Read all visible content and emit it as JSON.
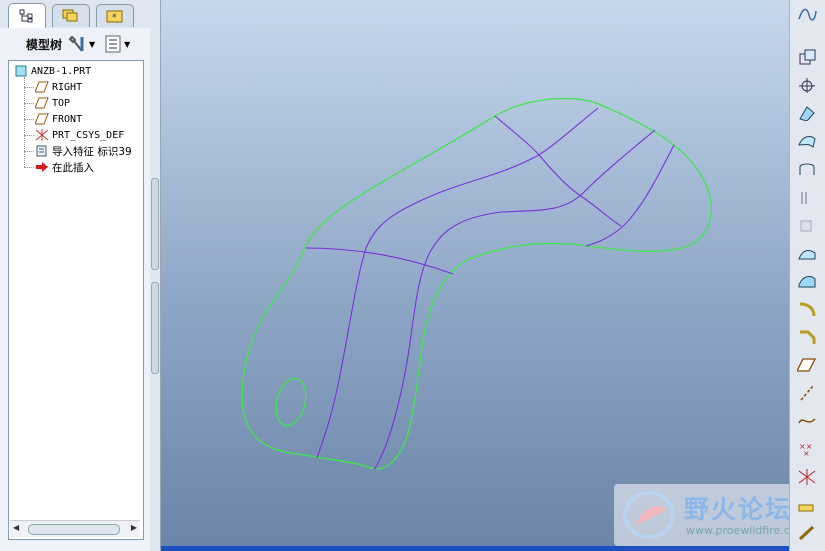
{
  "model_tree": {
    "title": "模型树",
    "items": [
      {
        "label": "ANZB-1.PRT",
        "icon": "part-icon"
      },
      {
        "label": "RIGHT",
        "icon": "datum-plane-icon"
      },
      {
        "label": "TOP",
        "icon": "datum-plane-icon"
      },
      {
        "label": "FRONT",
        "icon": "datum-plane-icon"
      },
      {
        "label": "PRT_CSYS_DEF",
        "icon": "csys-icon"
      },
      {
        "label": "导入特征 标识39",
        "icon": "import-feature-icon"
      },
      {
        "label": "在此插入",
        "icon": "insert-here-icon"
      }
    ]
  },
  "tabs": [
    "model-tree-tab",
    "folder-browser-tab",
    "favorites-tab"
  ],
  "right_toolbar": [
    "sketched-curve-icon",
    "datum-plane-tool-icon",
    "datum-axis-icon",
    "blend-icon",
    "boundary-blend-icon",
    "surface-icon",
    "extend-icon",
    "offset-icon",
    "merge-icon",
    "trim-icon",
    "round-icon",
    "chamfer-icon",
    "plane-icon",
    "axis-icon",
    "curve-icon",
    "point-icon",
    "csys-tool-icon",
    "analysis-icon",
    "measure-icon"
  ],
  "watermark": {
    "text": "野火论坛",
    "url": "www.proewildfire.cn"
  },
  "colors": {
    "boundary": "#3ee84a",
    "internal": "#7a32d6",
    "viewport_bottom": "#1c4fbf"
  }
}
